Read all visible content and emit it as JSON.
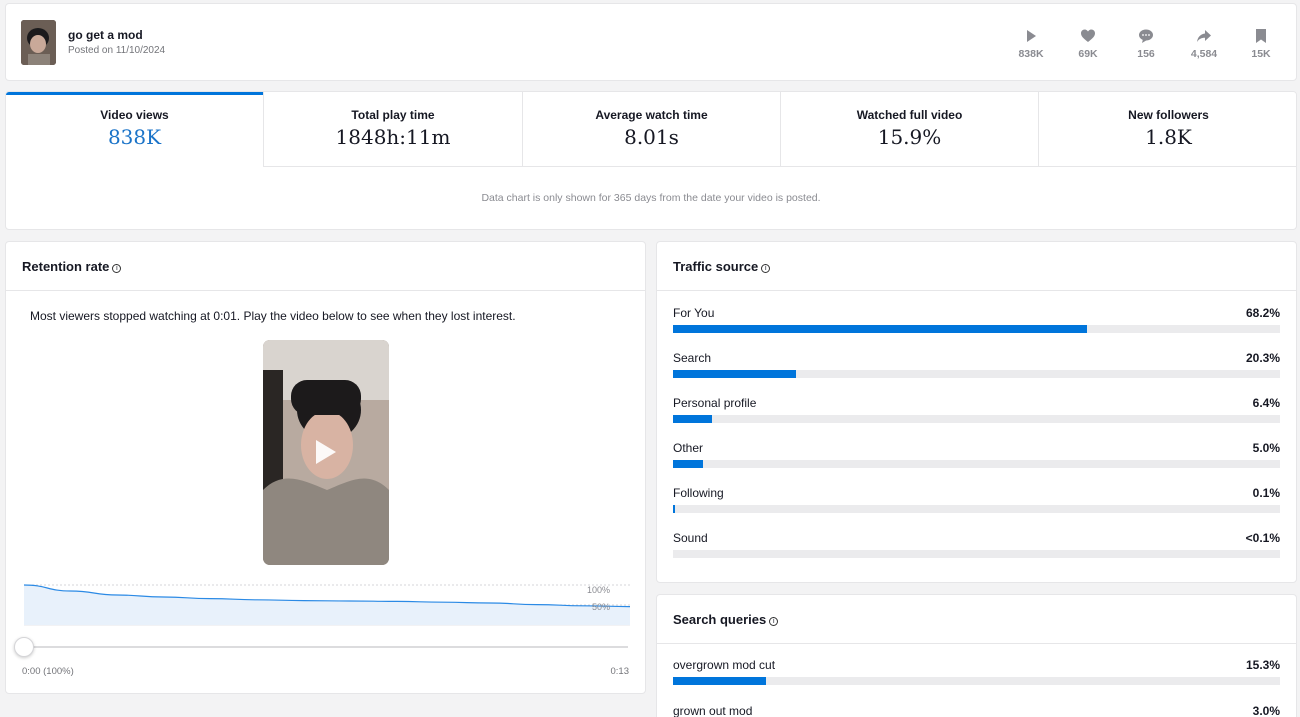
{
  "header": {
    "title": "go get a mod",
    "posted": "Posted on 11/10/2024",
    "stats": [
      {
        "icon": "play-icon",
        "value": "838K"
      },
      {
        "icon": "heart-icon",
        "value": "69K"
      },
      {
        "icon": "comment-icon",
        "value": "156"
      },
      {
        "icon": "share-icon",
        "value": "4,584"
      },
      {
        "icon": "bookmark-icon",
        "value": "15K"
      }
    ]
  },
  "metrics": {
    "tabs": [
      {
        "label": "Video views",
        "value": "838K"
      },
      {
        "label": "Total play time",
        "value": "1848h:11m"
      },
      {
        "label": "Average watch time",
        "value": "8.01s"
      },
      {
        "label": "Watched full video",
        "value": "15.9%"
      },
      {
        "label": "New followers",
        "value": "1.8K"
      }
    ],
    "active_tab": 0,
    "note": "Data chart is only shown for 365 days from the date your video is posted."
  },
  "retention": {
    "title": "Retention rate",
    "message": "Most viewers stopped watching at 0:01. Play the video below to see when they lost interest.",
    "tick_100": "100%",
    "tick_50": "50%",
    "time_start": "0:00 (100%)",
    "time_end": "0:13",
    "chart_data": {
      "type": "area",
      "x": [
        0,
        1,
        2,
        3,
        4,
        5,
        6,
        7,
        8,
        9,
        10,
        11,
        12,
        13
      ],
      "y": [
        100,
        85,
        75,
        70,
        66,
        63,
        61,
        60,
        59,
        57,
        55,
        51,
        48,
        46
      ],
      "ylim": [
        0,
        100
      ],
      "xlabel": "",
      "ylabel": ""
    }
  },
  "traffic": {
    "title": "Traffic source",
    "sources": [
      {
        "name": "For You",
        "pct": "68.2%",
        "value": 68.2
      },
      {
        "name": "Search",
        "pct": "20.3%",
        "value": 20.3
      },
      {
        "name": "Personal profile",
        "pct": "6.4%",
        "value": 6.4
      },
      {
        "name": "Other",
        "pct": "5.0%",
        "value": 5.0
      },
      {
        "name": "Following",
        "pct": "0.1%",
        "value": 0.1
      },
      {
        "name": "Sound",
        "pct": "<0.1%",
        "value": 0
      }
    ]
  },
  "search_queries": {
    "title": "Search queries",
    "queries": [
      {
        "name": "overgrown mod cut",
        "pct": "15.3%",
        "value": 15.3
      },
      {
        "name": "grown out mod",
        "pct": "3.0%",
        "value": 3.0
      }
    ]
  },
  "colors": {
    "accent": "#0075db",
    "active_value": "#1a73c8"
  }
}
